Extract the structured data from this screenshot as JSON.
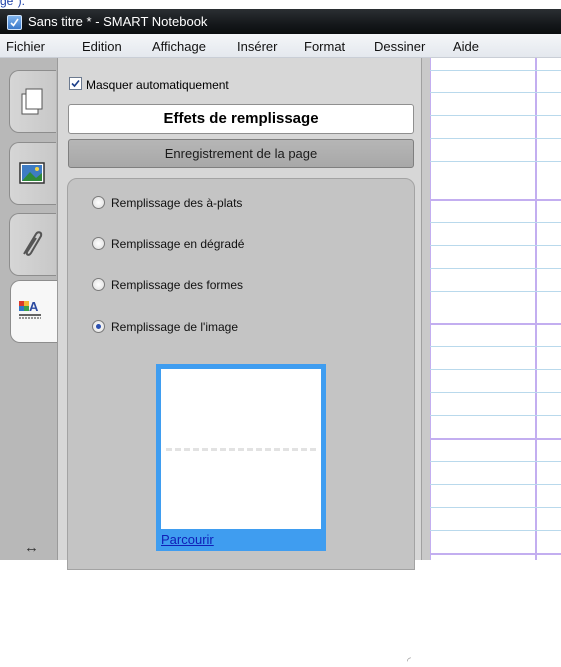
{
  "top_snippet": "ge\").",
  "window": {
    "title": "Sans titre * - SMART Notebook"
  },
  "menu": [
    "Fichier",
    "Edition",
    "Affichage",
    "Insérer",
    "Format",
    "Dessiner",
    "Aide"
  ],
  "side_tabs": [
    {
      "icon": "page-sorter-icon"
    },
    {
      "icon": "gallery-icon"
    },
    {
      "icon": "attachments-icon"
    },
    {
      "icon": "properties-icon",
      "active": true
    }
  ],
  "resize_icon": "horizontal-resize-icon",
  "panel": {
    "auto_hide_label": "Masquer automatiquement",
    "auto_hide_checked": true,
    "section_title": "Effets de remplissage",
    "save_page_button": "Enregistrement de la page",
    "fill_options": [
      {
        "label": "Remplissage des à-plats",
        "selected": false
      },
      {
        "label": "Remplissage en dégradé",
        "selected": false
      },
      {
        "label": "Remplissage des formes",
        "selected": false
      },
      {
        "label": "Remplissage de l'image",
        "selected": true
      }
    ],
    "browse_link": "Parcourir"
  },
  "colors": {
    "titlebar": "#15181b",
    "accent_blue": "#3f9df0",
    "grid_purple": "#c3aef0",
    "grid_blue": "#b9d9ec"
  }
}
